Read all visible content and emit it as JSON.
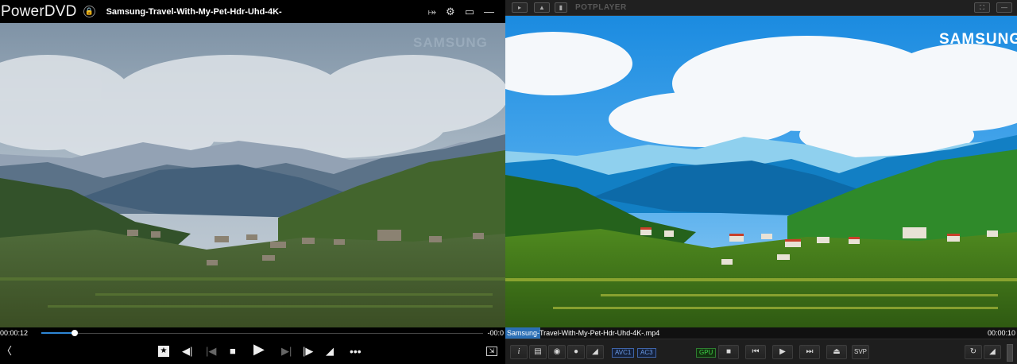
{
  "powerdvd": {
    "app_name": "PowerDVD",
    "title": "Samsung-Travel-With-My-Pet-Hdr-Uhd-4K-",
    "watermark": "SAMSUNG",
    "elapsed": "00:00:12",
    "remaining": "-00:0",
    "progress_fraction": 0.075,
    "icons": {
      "lock": "lock-icon",
      "share": "share-icon",
      "settings": "gear-icon",
      "cast": "tv-icon",
      "minimize": "minimize-icon",
      "back": "back-icon",
      "bookmark": "star-bookmark-icon",
      "previous_chapter": "previous-chapter-icon",
      "skip_back": "skip-back-icon",
      "stop": "stop-icon",
      "play": "play-icon",
      "skip_forward": "skip-forward-icon",
      "next_chapter": "next-chapter-icon",
      "volume": "volume-icon",
      "more": "more-icon",
      "fullscreen": "fullscreen-icon"
    }
  },
  "potplayer": {
    "app_name": "POTPLAYER",
    "watermark": "SAMSUNG",
    "file_name": "Samsung-Travel-With-My-Pet-Hdr-Uhd-4K-.mp4",
    "time": "00:00:10",
    "codecs": [
      "AVC1",
      "AC3"
    ],
    "gpu_label": "GPU",
    "svp_label": "SVP",
    "info_label": "i",
    "volume_fraction": 1.0
  },
  "colors": {
    "powerdvd_progress": "#2e86d6",
    "potplayer_highlight": "#2b6fb5",
    "gpu_green": "#3fd24a",
    "codec_blue": "#6a9be6"
  }
}
